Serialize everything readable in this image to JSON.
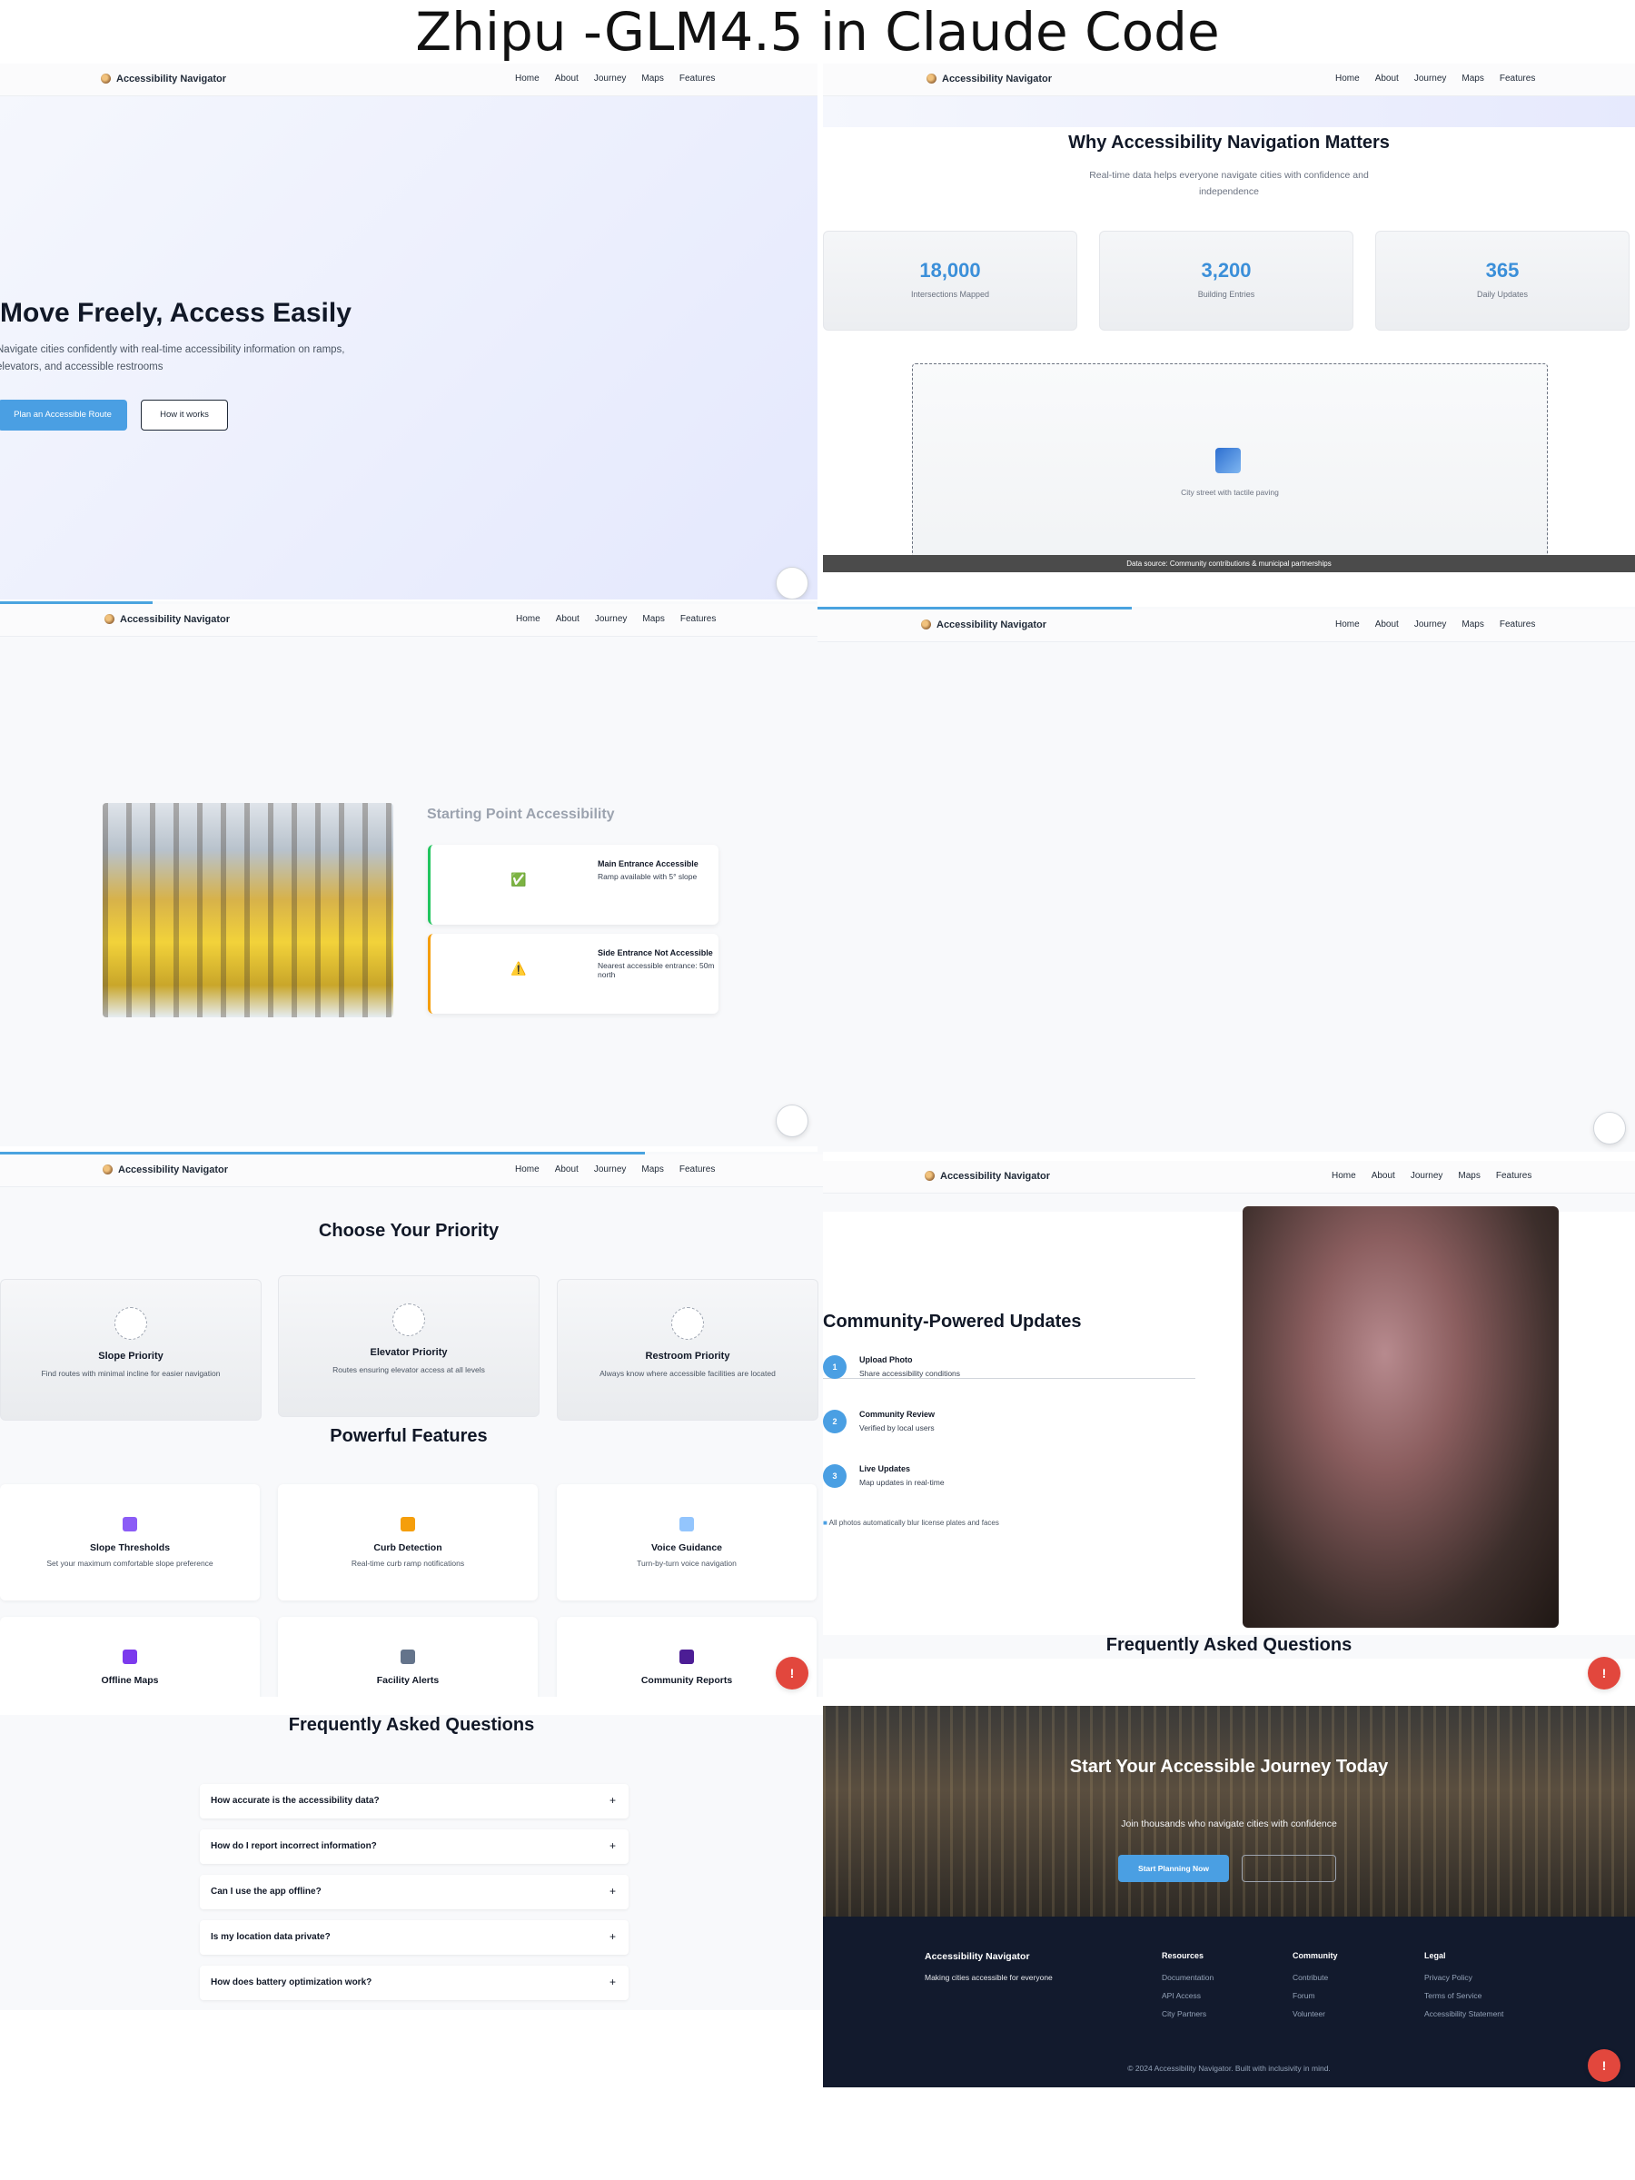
{
  "heading": "Zhipu -GLM4.5 in Claude Code",
  "nav": {
    "brand": "Accessibility Navigator",
    "links": [
      "Home",
      "About",
      "Journey",
      "Maps",
      "Features"
    ]
  },
  "hero": {
    "title": "Move Freely, Access Easily",
    "subtitle": "Navigate cities confidently with real-time accessibility information on ramps, elevators, and accessible restrooms",
    "primary_btn": "Plan an Accessible Route",
    "secondary_btn": "How it works"
  },
  "why": {
    "title": "Why Accessibility Navigation Matters",
    "lead": "Real-time data helps everyone navigate cities with confidence and independence",
    "stats": [
      {
        "num": "18,000",
        "label": "Intersections Mapped"
      },
      {
        "num": "3,200",
        "label": "Building Entries"
      },
      {
        "num": "365",
        "label": "Daily Updates"
      }
    ],
    "image_caption": "City street with tactile paving",
    "source": "Data source: Community contributions & municipal partnerships"
  },
  "start": {
    "title": "Starting Point Accessibility",
    "cards": [
      {
        "icon": "✅",
        "heading": "Main Entrance Accessible",
        "detail": "Ramp available with 5° slope",
        "accent": "#22c55e"
      },
      {
        "icon": "⚠️",
        "heading": "Side Entrance Not Accessible",
        "detail": "Nearest accessible entrance: 50m north",
        "accent": "#f59e0b"
      }
    ]
  },
  "priority": {
    "title": "Choose Your Priority",
    "cards": [
      {
        "title": "Slope Priority",
        "desc": "Find routes with minimal incline for easier navigation"
      },
      {
        "title": "Elevator Priority",
        "desc": "Routes ensuring elevator access at all levels"
      },
      {
        "title": "Restroom Priority",
        "desc": "Always know where accessible facilities are located"
      }
    ]
  },
  "features": {
    "title": "Powerful Features",
    "cards": [
      {
        "title": "Slope Thresholds",
        "desc": "Set your maximum comfortable slope preference",
        "color": "#8b5cf6"
      },
      {
        "title": "Curb Detection",
        "desc": "Real-time curb ramp notifications",
        "color": "#f59e0b"
      },
      {
        "title": "Voice Guidance",
        "desc": "Turn-by-turn voice navigation",
        "color": "#93c5fd"
      },
      {
        "title": "Offline Maps",
        "desc": "",
        "color": "#7c3aed"
      },
      {
        "title": "Facility Alerts",
        "desc": "",
        "color": "#64748b"
      },
      {
        "title": "Community Reports",
        "desc": "",
        "color": "#4c1d95"
      }
    ]
  },
  "community": {
    "title": "Community-Powered Updates",
    "steps": [
      {
        "n": "1",
        "heading": "Upload Photo",
        "detail": "Share accessibility conditions"
      },
      {
        "n": "2",
        "heading": "Community Review",
        "detail": "Verified by local users"
      },
      {
        "n": "3",
        "heading": "Live Updates",
        "detail": "Map updates in real-time"
      }
    ],
    "note": "All photos automatically blur license plates and faces"
  },
  "faq": {
    "title": "Frequently Asked Questions",
    "questions": [
      "How accurate is the accessibility data?",
      "How do I report incorrect information?",
      "Can I use the app offline?",
      "Is my location data private?",
      "How does battery optimization work?"
    ]
  },
  "cta": {
    "title": "Start Your Accessible Journey Today",
    "subtitle": "Join thousands who navigate cities with confidence",
    "primary_btn": "Start Planning Now"
  },
  "footer": {
    "brand": "Accessibility Navigator",
    "tagline": "Making cities accessible for everyone",
    "columns": [
      {
        "heading": "Resources",
        "items": [
          "Documentation",
          "API Access",
          "City Partners"
        ]
      },
      {
        "heading": "Community",
        "items": [
          "Contribute",
          "Forum",
          "Volunteer"
        ]
      },
      {
        "heading": "Legal",
        "items": [
          "Privacy Policy",
          "Terms of Service",
          "Accessibility Statement"
        ]
      }
    ],
    "copyright": "© 2024 Accessibility Navigator. Built with inclusivity in mind."
  },
  "colors": {
    "accent": "#4a9fe3",
    "alert": "#e2473d",
    "footer": "#121a2d"
  }
}
